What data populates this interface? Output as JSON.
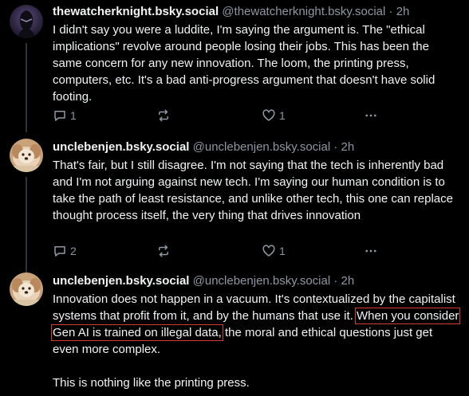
{
  "colors": {
    "background": "#000000",
    "text": "#f1f3f5",
    "muted": "#8d97a3",
    "highlight_box": "#d23a34"
  },
  "posts": [
    {
      "display_name": "thewatcherknight.bsky.social",
      "handle": "@thewatcherknight.bsky.social",
      "separator": "·",
      "time": "2h",
      "avatar_icon": "dark-knight-avatar",
      "body": "I didn't say you were a luddite, I'm saying the argument is. The \"ethical implications\" revolve around people losing their jobs. This has been the same concern for any new innovation. The loom, the printing press, computers, etc. It's a bad anti-progress argument that doesn't have solid footing.",
      "reply_count": "1",
      "repost_count": "",
      "like_count": "1"
    },
    {
      "display_name": "unclebenjen.bsky.social",
      "handle": "@unclebenjen.bsky.social",
      "separator": "·",
      "time": "2h",
      "avatar_icon": "fluffy-dog-avatar",
      "body": "That's fair, but I still disagree. I'm not saying that the tech is inherently bad and I'm not arguing against new tech. I'm saying our human condition is to take the path of least resistance, and unlike other tech, this one can replace thought process itself, the very thing that drives innovation",
      "reply_count": "2",
      "repost_count": "",
      "like_count": "1"
    },
    {
      "display_name": "unclebenjen.bsky.social",
      "handle": "@unclebenjen.bsky.social",
      "separator": "·",
      "time": "2h",
      "avatar_icon": "fluffy-dog-avatar",
      "body_before": "Innovation does not happen in a vacuum. It's contextualized by the capitalist systems that profit from it, and by the humans that use it. ",
      "body_highlight": "When you consider Gen AI is trained on illegal data,",
      "body_after": " the moral and ethical questions just get even more complex.",
      "body_second_para": "This is nothing like the printing press."
    }
  ]
}
